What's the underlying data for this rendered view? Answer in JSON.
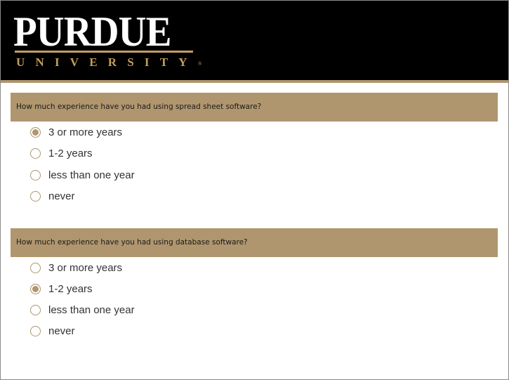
{
  "logo": {
    "wordmark": "PURDUE",
    "subtitle": "UNIVERSITY",
    "trademark": "®"
  },
  "colors": {
    "brand_gold": "#b0966e",
    "logo_gold": "#c29e5b",
    "header_background": "#000000"
  },
  "questions": [
    {
      "text": "How much experience have you had using spread sheet software?",
      "options": [
        {
          "label": "3 or more years",
          "selected": true
        },
        {
          "label": "1-2 years",
          "selected": false
        },
        {
          "label": "less than one year",
          "selected": false
        },
        {
          "label": "never",
          "selected": false
        }
      ]
    },
    {
      "text": "How much experience have you had using database software?",
      "options": [
        {
          "label": "3 or more years",
          "selected": false
        },
        {
          "label": "1-2 years",
          "selected": true
        },
        {
          "label": "less than one year",
          "selected": false
        },
        {
          "label": "never",
          "selected": false
        }
      ]
    }
  ]
}
